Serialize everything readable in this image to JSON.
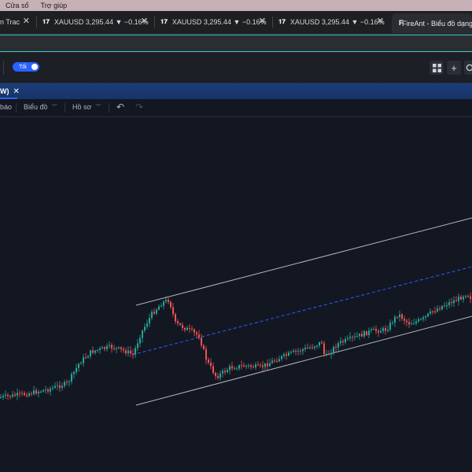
{
  "menubar": {
    "items": [
      "Cửa sổ",
      "Trợ giúp"
    ]
  },
  "tabs": [
    {
      "label": "n Trac"
    },
    {
      "label": "XAUUSD 3,295.44 ▼ −0.16%"
    },
    {
      "label": "XAUUSD 3,295.44 ▼ −0.16%"
    },
    {
      "label": "XAUUSD 3,295.44 ▼ −0.16%"
    },
    {
      "label": "FireAnt - Biểu đồ dạng"
    }
  ],
  "toolbar": {
    "theme_toggle_label": "Tối"
  },
  "sheet": {
    "tab_label": "W)"
  },
  "chart_menu": {
    "item0": "báo",
    "item1": "Biểu đồ",
    "item2": "Hồ sơ"
  },
  "colors": {
    "up": "#26a69a",
    "down": "#ef5350",
    "channel": "#b2b5be",
    "midline": "#2962ff",
    "accent_url": "#2dc7c7"
  },
  "chart_data": {
    "type": "candlestick",
    "annotations": [
      "parallel channel: upper line",
      "parallel channel: dashed median",
      "parallel channel: lower line"
    ],
    "grid": false
  }
}
